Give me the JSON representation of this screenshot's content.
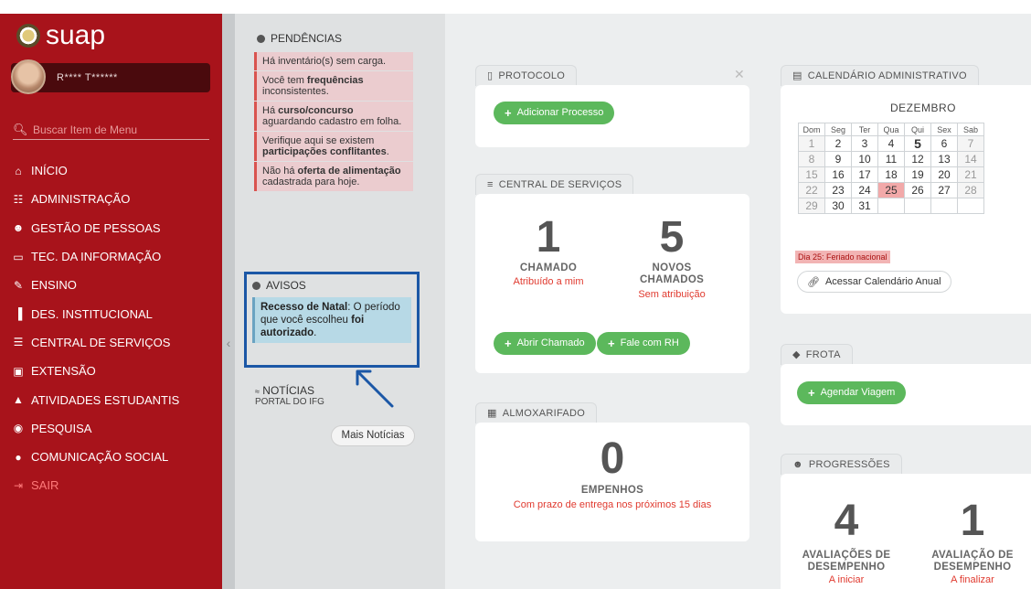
{
  "brand": {
    "name": "suap"
  },
  "user": {
    "name": "R**** T******"
  },
  "search": {
    "placeholder": "Buscar Item de Menu"
  },
  "menu": [
    {
      "label": "INÍCIO",
      "icon": "home-icon"
    },
    {
      "label": "ADMINISTRAÇÃO",
      "icon": "list-icon"
    },
    {
      "label": "GESTÃO DE PESSOAS",
      "icon": "people-icon"
    },
    {
      "label": "TEC. DA INFORMAÇÃO",
      "icon": "laptop-icon"
    },
    {
      "label": "ENSINO",
      "icon": "pencil-icon"
    },
    {
      "label": "DES. INSTITUCIONAL",
      "icon": "bar-chart-icon"
    },
    {
      "label": "CENTRAL DE SERVIÇOS",
      "icon": "list-lines-icon"
    },
    {
      "label": "EXTENSÃO",
      "icon": "briefcase-icon"
    },
    {
      "label": "ATIVIDADES ESTUDANTIS",
      "icon": "graduation-cap-icon"
    },
    {
      "label": "PESQUISA",
      "icon": "compass-icon"
    },
    {
      "label": "COMUNICAÇÃO SOCIAL",
      "icon": "chat-icon"
    },
    {
      "label": "SAIR",
      "icon": "exit-icon"
    }
  ],
  "pendencias": {
    "title": "PENDÊNCIAS",
    "items": [
      {
        "pre": "Há inventário(s) sem carga.",
        "bold": "",
        "post": ""
      },
      {
        "pre": "Você tem ",
        "bold": "frequências",
        "post": " inconsistentes."
      },
      {
        "pre": "Há ",
        "bold": "curso/concurso",
        "post": " aguardando cadastro em folha."
      },
      {
        "pre": "Verifique aqui se existem ",
        "bold": "participações conflitantes",
        "post": "."
      },
      {
        "pre": "Não há ",
        "bold": "oferta de alimentação",
        "post": " cadastrada para hoje."
      }
    ]
  },
  "avisos": {
    "title": "AVISOS",
    "bold1": "Recesso de Natal",
    "text1": ": O período que você escolheu ",
    "bold2": "foi autorizado",
    "text2": "."
  },
  "noticias": {
    "title": "NOTÍCIAS",
    "subtitle": "PORTAL DO IFG",
    "more": "Mais Notícias"
  },
  "protocolo": {
    "title": "PROTOCOLO",
    "button": "Adicionar Processo"
  },
  "central_servicos": {
    "title": "CENTRAL DE SERVIÇOS",
    "stat1": {
      "value": "1",
      "label": "CHAMADO",
      "sub": "Atribuído a mim"
    },
    "stat2": {
      "value": "5",
      "label1": "NOVOS",
      "label2": "CHAMADOS",
      "sub": "Sem atribuição"
    },
    "btn1": "Abrir Chamado",
    "btn2": "Fale com RH"
  },
  "almoxarifado": {
    "title": "ALMOXARIFADO",
    "value": "0",
    "label": "EMPENHOS",
    "sub": "Com prazo de entrega nos próximos 15 dias"
  },
  "calendario": {
    "title": "CALENDÁRIO ADMINISTRATIVO",
    "month": "DEZEMBRO",
    "weekdays": [
      "Dom",
      "Seg",
      "Ter",
      "Qua",
      "Qui",
      "Sex",
      "Sab"
    ],
    "weeks": [
      [
        "1",
        "2",
        "3",
        "4",
        "5",
        "6",
        "7"
      ],
      [
        "8",
        "9",
        "10",
        "11",
        "12",
        "13",
        "14"
      ],
      [
        "15",
        "16",
        "17",
        "18",
        "19",
        "20",
        "21"
      ],
      [
        "22",
        "23",
        "24",
        "25",
        "26",
        "27",
        "28"
      ],
      [
        "29",
        "30",
        "31",
        "",
        "",
        "",
        ""
      ]
    ],
    "holiday": "Dia 25: Feriado nacional",
    "link": "Acessar Calendário Anual"
  },
  "frota": {
    "title": "FROTA",
    "button": "Agendar Viagem"
  },
  "progressoes": {
    "title": "PROGRESSÕES",
    "stat1": {
      "value": "4",
      "label1": "AVALIAÇÕES DE",
      "label2": "DESEMPENHO",
      "sub": "A iniciar"
    },
    "stat2": {
      "value": "1",
      "label1": "AVALIAÇÃO DE",
      "label2": "DESEMPENHO",
      "sub": "A finalizar"
    }
  },
  "colors": {
    "sidebar": "#a8131b",
    "green": "#5cb85c",
    "alert_red": "#e03a2f",
    "highlight_border": "#1b57a6"
  }
}
